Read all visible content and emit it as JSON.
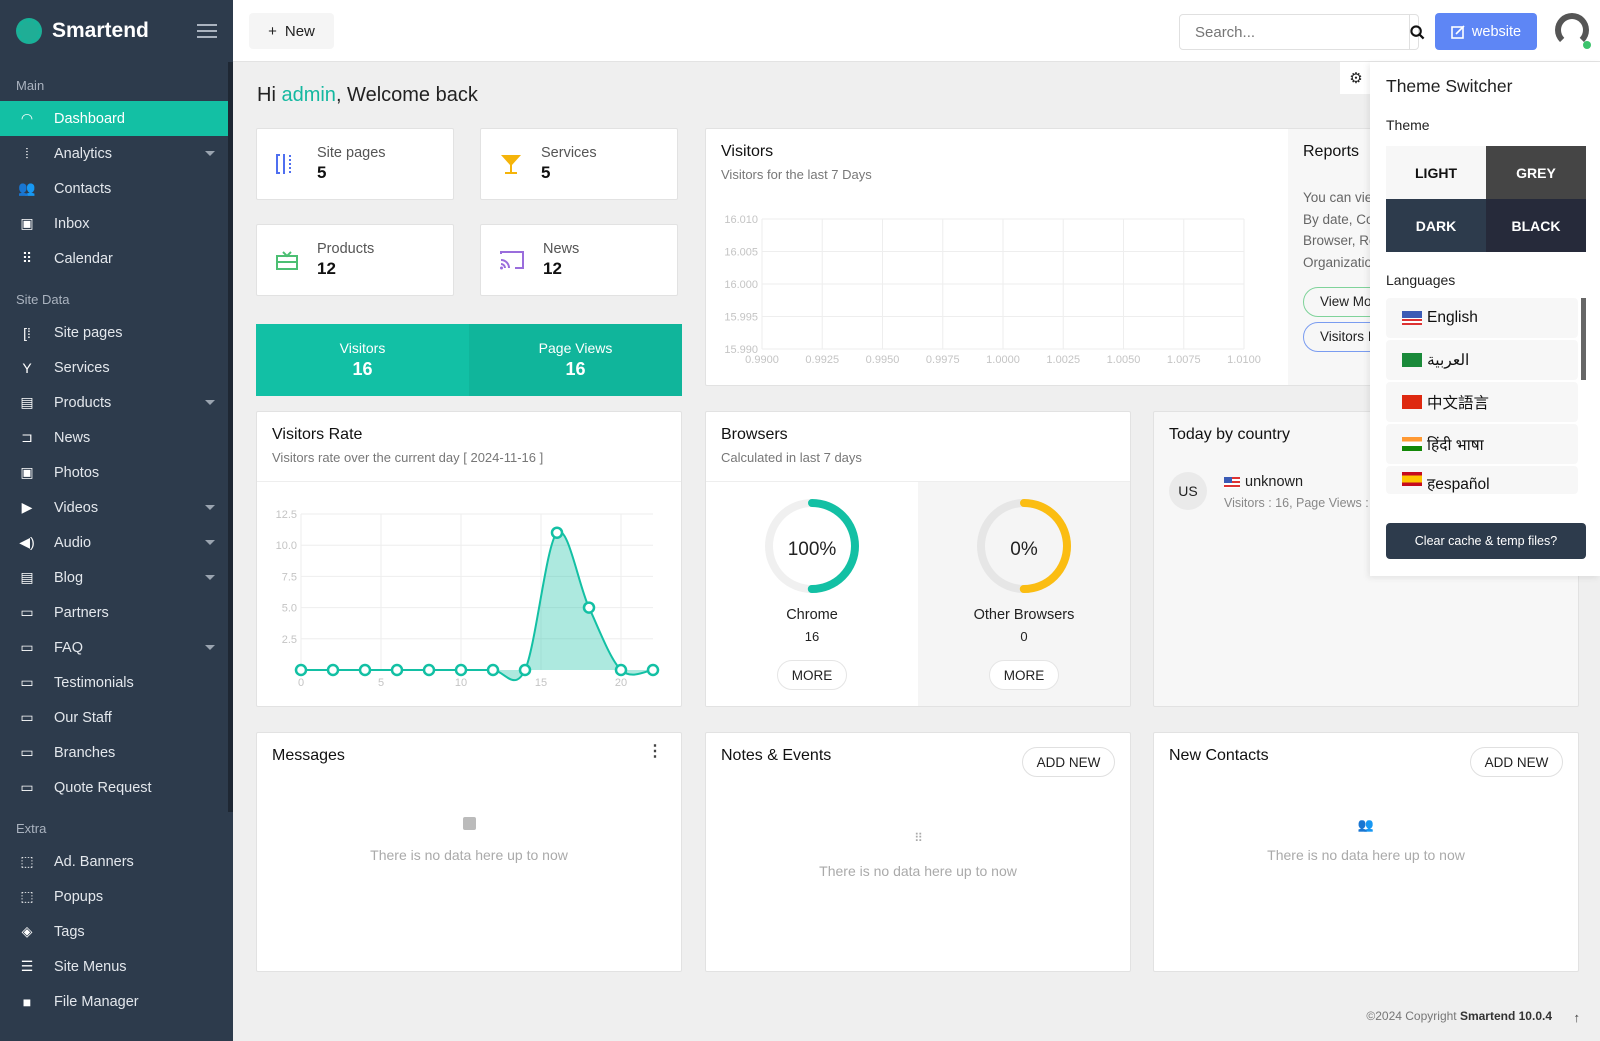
{
  "app": {
    "name": "Smartend"
  },
  "sidebar": {
    "sections": [
      {
        "label": "Main",
        "items": [
          {
            "label": "Dashboard",
            "icon": "dashboard-icon",
            "active": true
          },
          {
            "label": "Analytics",
            "icon": "analytics-icon",
            "caret": true
          },
          {
            "label": "Contacts",
            "icon": "contacts-icon"
          },
          {
            "label": "Inbox",
            "icon": "inbox-icon"
          },
          {
            "label": "Calendar",
            "icon": "calendar-icon"
          }
        ]
      },
      {
        "label": "Site Data",
        "items": [
          {
            "label": "Site pages",
            "icon": "site-pages-icon"
          },
          {
            "label": "Services",
            "icon": "services-icon"
          },
          {
            "label": "Products",
            "icon": "products-icon",
            "caret": true
          },
          {
            "label": "News",
            "icon": "news-icon"
          },
          {
            "label": "Photos",
            "icon": "photos-icon"
          },
          {
            "label": "Videos",
            "icon": "videos-icon",
            "caret": true
          },
          {
            "label": "Audio",
            "icon": "audio-icon",
            "caret": true
          },
          {
            "label": "Blog",
            "icon": "blog-icon",
            "caret": true
          },
          {
            "label": "Partners",
            "icon": "folder-icon"
          },
          {
            "label": "FAQ",
            "icon": "folder-icon",
            "caret": true
          },
          {
            "label": "Testimonials",
            "icon": "folder-icon"
          },
          {
            "label": "Our Staff",
            "icon": "folder-icon"
          },
          {
            "label": "Branches",
            "icon": "folder-icon"
          },
          {
            "label": "Quote Request",
            "icon": "folder-icon"
          }
        ]
      },
      {
        "label": "Extra",
        "items": [
          {
            "label": "Ad. Banners",
            "icon": "banners-icon"
          },
          {
            "label": "Popups",
            "icon": "popups-icon"
          },
          {
            "label": "Tags",
            "icon": "tags-icon"
          },
          {
            "label": "Site Menus",
            "icon": "menus-icon"
          },
          {
            "label": "File Manager",
            "icon": "file-manager-icon"
          }
        ]
      }
    ]
  },
  "topbar": {
    "new_label": "New",
    "search_placeholder": "Search...",
    "website_label": "website"
  },
  "welcome": {
    "prefix": "Hi ",
    "user": "admin",
    "suffix": ", Welcome back"
  },
  "stats": [
    {
      "label": "Site pages",
      "value": "5",
      "color": "#4f6ff0"
    },
    {
      "label": "Services",
      "value": "5",
      "color": "#f5b40a"
    },
    {
      "label": "Products",
      "value": "12",
      "color": "#4cbf73"
    },
    {
      "label": "News",
      "value": "12",
      "color": "#9a6ddc"
    }
  ],
  "band": {
    "visitors_label": "Visitors",
    "visitors_value": "16",
    "pageviews_label": "Page Views",
    "pageviews_value": "16"
  },
  "visitors_card": {
    "title": "Visitors",
    "subtitle": "Visitors for the last 7 Days"
  },
  "reports": {
    "title": "Reports",
    "lines": [
      "You can vie",
      "By date, Co",
      "Browser, Re",
      "Organizatio"
    ],
    "btn1": "View Mo",
    "btn2": "Visitors I"
  },
  "visitors_rate": {
    "title": "Visitors Rate",
    "subtitle": "Visitors rate over the current day [ 2024-11-16 ]"
  },
  "browsers": {
    "title": "Browsers",
    "subtitle": "Calculated in last 7 days",
    "items": [
      {
        "name": "Chrome",
        "count": "16",
        "percent": "100%",
        "fraction": 1.0,
        "color": "#13c0a4"
      },
      {
        "name": "Other Browsers",
        "count": "0",
        "percent": "0%",
        "fraction": 0.5,
        "color": "#fbbd12"
      }
    ],
    "more_label": "MORE"
  },
  "country": {
    "title": "Today by country",
    "code": "US",
    "name": "unknown",
    "detail": "Visitors : 16, Page Views :"
  },
  "messages": {
    "title": "Messages",
    "empty": "There is no data here up to now"
  },
  "notes": {
    "title": "Notes & Events",
    "add": "ADD NEW",
    "empty": "There is no data here up to now"
  },
  "contacts": {
    "title": "New Contacts",
    "add": "ADD NEW",
    "empty": "There is no data here up to now"
  },
  "theme_switcher": {
    "title": "Theme Switcher",
    "theme_label": "Theme",
    "themes": [
      "LIGHT",
      "GREY",
      "DARK",
      "BLACK"
    ],
    "languages_label": "Languages",
    "languages": [
      "English",
      "العربية",
      "中文語言",
      "हिंदी भाषा",
      "हespañol"
    ],
    "clear_label": "Clear cache & temp files?"
  },
  "footer": {
    "text": "©2024 Copyright ",
    "brand": "Smartend 10.0.4"
  },
  "chart_data": [
    {
      "type": "line",
      "title": "Visitors",
      "x_ticks": [
        "0.9900",
        "0.9925",
        "0.9950",
        "0.9975",
        "1.0000",
        "1.0025",
        "1.0050",
        "1.0075",
        "1.0100"
      ],
      "y_ticks": [
        "15.990",
        "15.995",
        "16.000",
        "16.005",
        "16.010"
      ],
      "xlim": [
        0.99,
        1.01
      ],
      "ylim": [
        15.99,
        16.01
      ],
      "grid": true,
      "series": []
    },
    {
      "type": "area",
      "title": "Visitors Rate",
      "x": [
        0,
        2,
        4,
        6,
        8,
        10,
        12,
        14,
        16,
        18,
        20,
        22
      ],
      "values": [
        0,
        0,
        0,
        0,
        0,
        0,
        0,
        0,
        11,
        5,
        0,
        0
      ],
      "x_ticks": [
        "0",
        "5",
        "10",
        "15",
        "20"
      ],
      "y_ticks": [
        "2.5",
        "5.0",
        "7.5",
        "10.0",
        "12.5"
      ],
      "xlim": [
        0,
        22
      ],
      "ylim": [
        0,
        12.5
      ],
      "grid": true,
      "color": "#13c0a4"
    }
  ]
}
